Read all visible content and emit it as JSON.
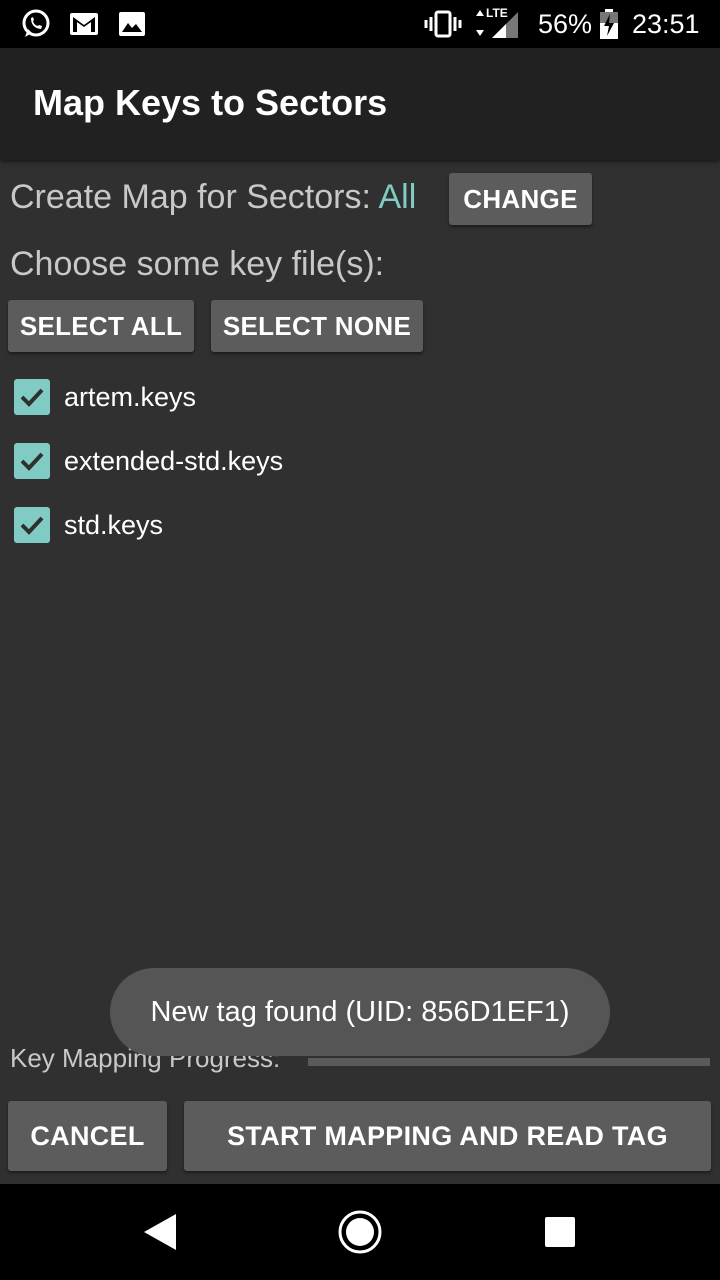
{
  "status_bar": {
    "icons_left": [
      "whatsapp-icon",
      "gmail-icon",
      "gallery-icon"
    ],
    "network_label": "LTE",
    "battery": "56%",
    "time": "23:51"
  },
  "app_bar": {
    "title": "Map Keys to Sectors"
  },
  "sectors": {
    "label": "Create Map for Sectors:",
    "value": "All",
    "change_button": "CHANGE"
  },
  "keys": {
    "label": "Choose some key file(s):",
    "select_all": "SELECT ALL",
    "select_none": "SELECT NONE",
    "files": [
      {
        "name": "artem.keys",
        "checked": true
      },
      {
        "name": "extended-std.keys",
        "checked": true
      },
      {
        "name": "std.keys",
        "checked": true
      }
    ]
  },
  "progress": {
    "label": "Key Mapping Progress:",
    "value": 0
  },
  "toast": {
    "text": "New tag found (UID: 856D1EF1)"
  },
  "actions": {
    "cancel": "CANCEL",
    "start": "START MAPPING AND READ TAG"
  },
  "colors": {
    "accent": "#80cbc4",
    "background": "#303030",
    "app_bar": "#212121",
    "button": "#5c5c5c"
  }
}
